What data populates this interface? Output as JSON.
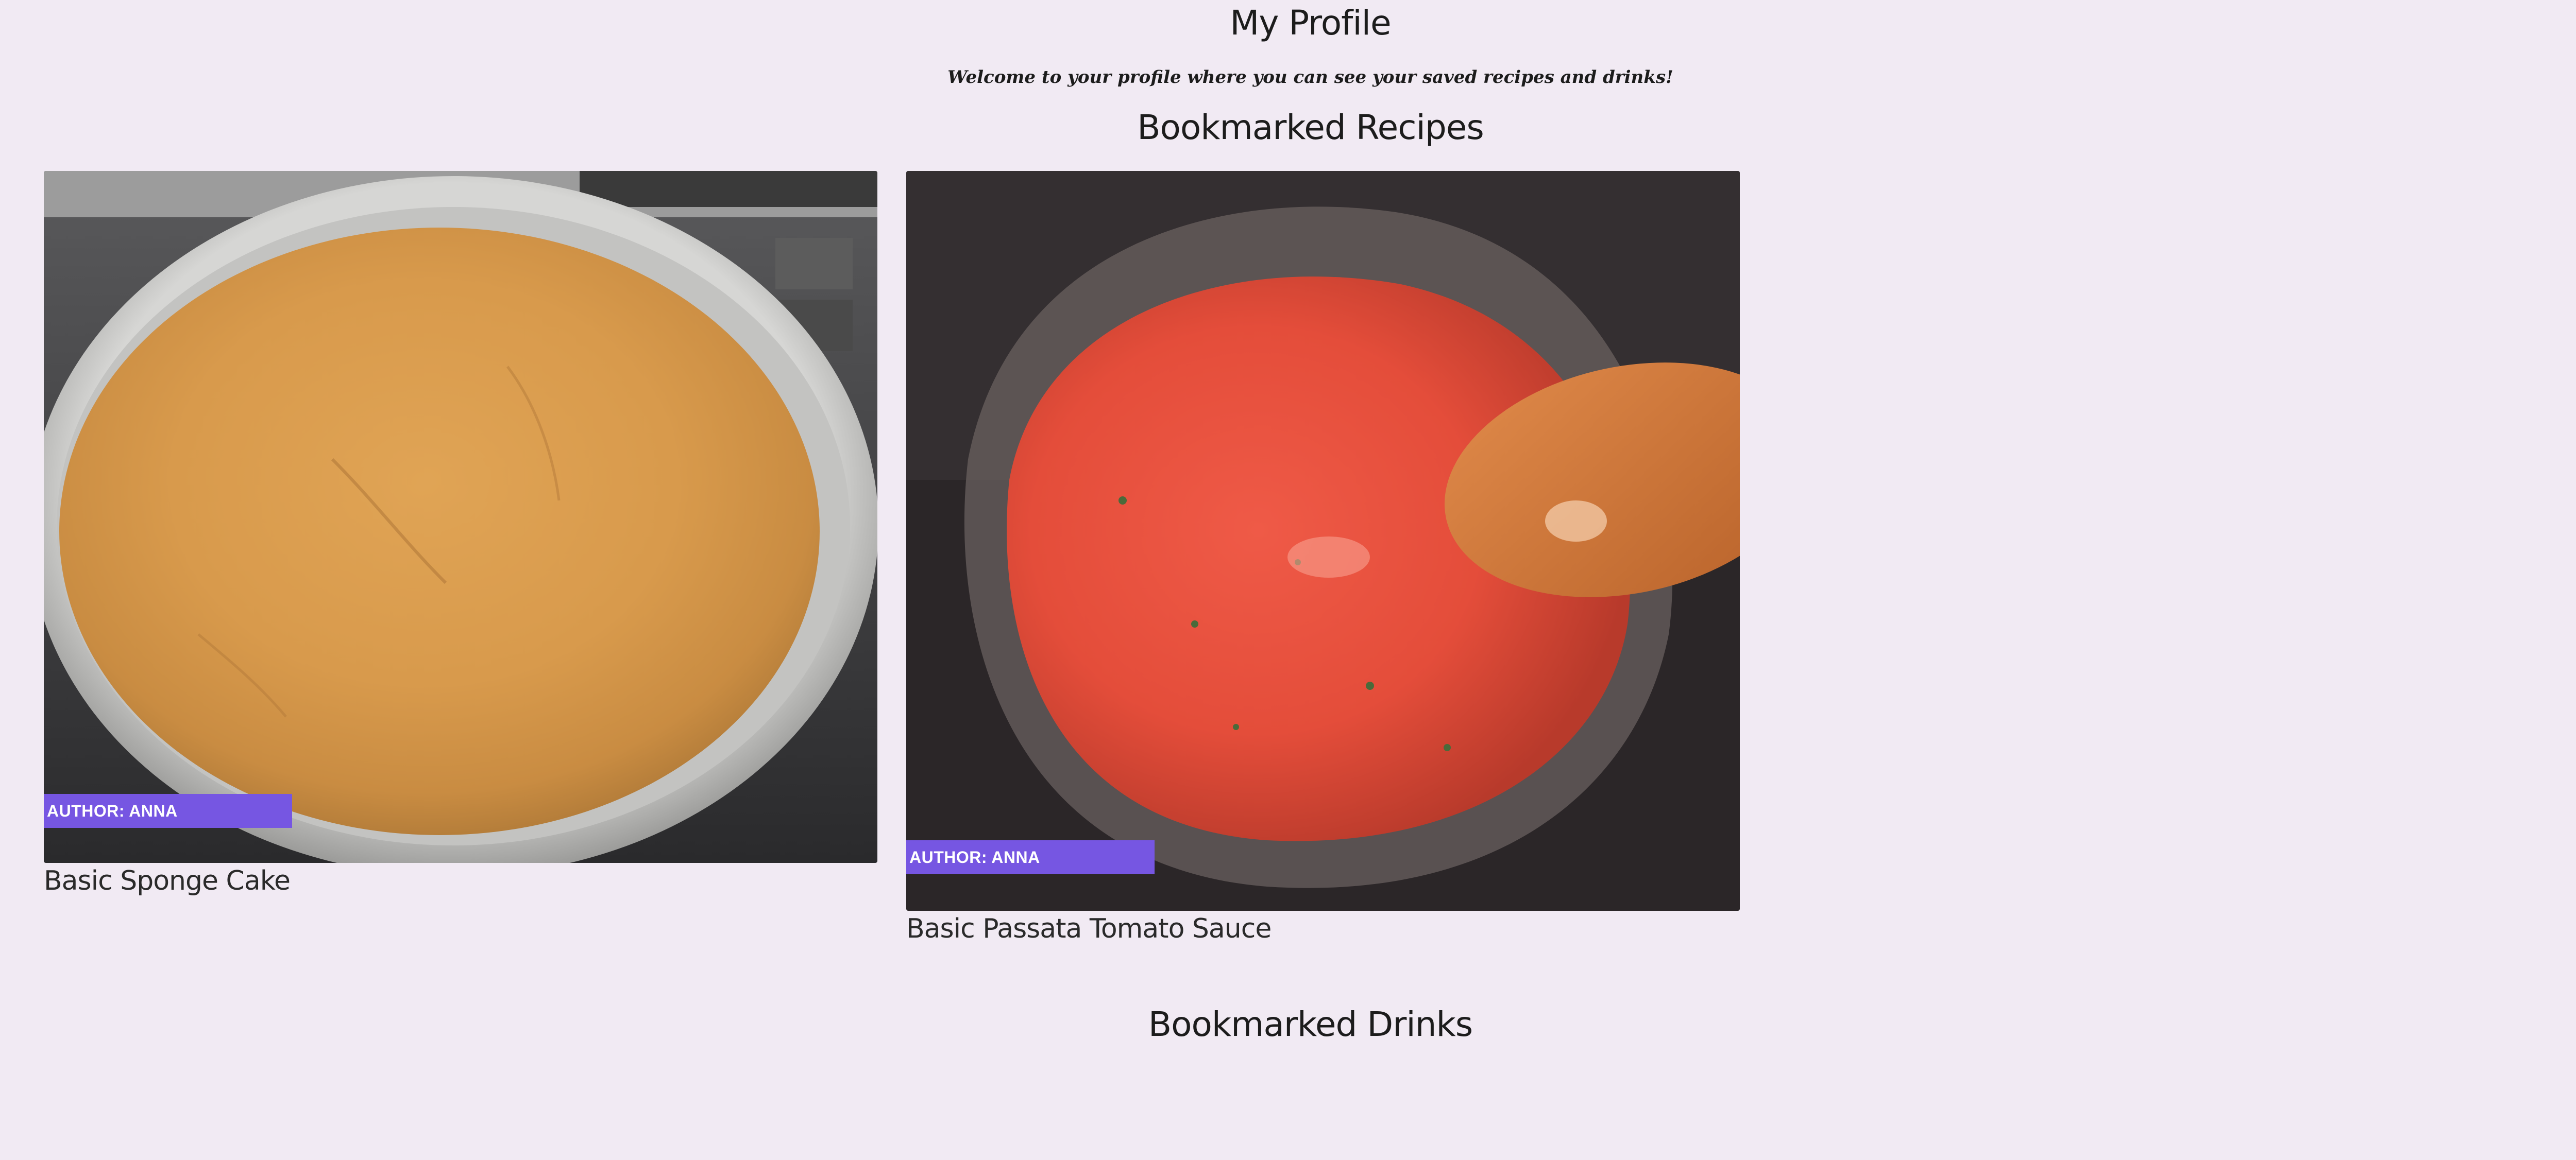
{
  "profile": {
    "title": "My Profile",
    "welcome": "Welcome to your profile where you can see your saved recipes and drinks!"
  },
  "recipes": {
    "heading": "Bookmarked Recipes",
    "items": [
      {
        "title": "Basic Sponge Cake",
        "author": "AUTHOR: ANNA"
      },
      {
        "title": "Basic Passata Tomato Sauce",
        "author": "AUTHOR: ANNA"
      }
    ]
  },
  "drinks": {
    "heading": "Bookmarked Drinks",
    "items": []
  },
  "colors": {
    "background": "#f1eaf3",
    "author_tag": "#7656e2",
    "text": "#1c1c1c"
  }
}
